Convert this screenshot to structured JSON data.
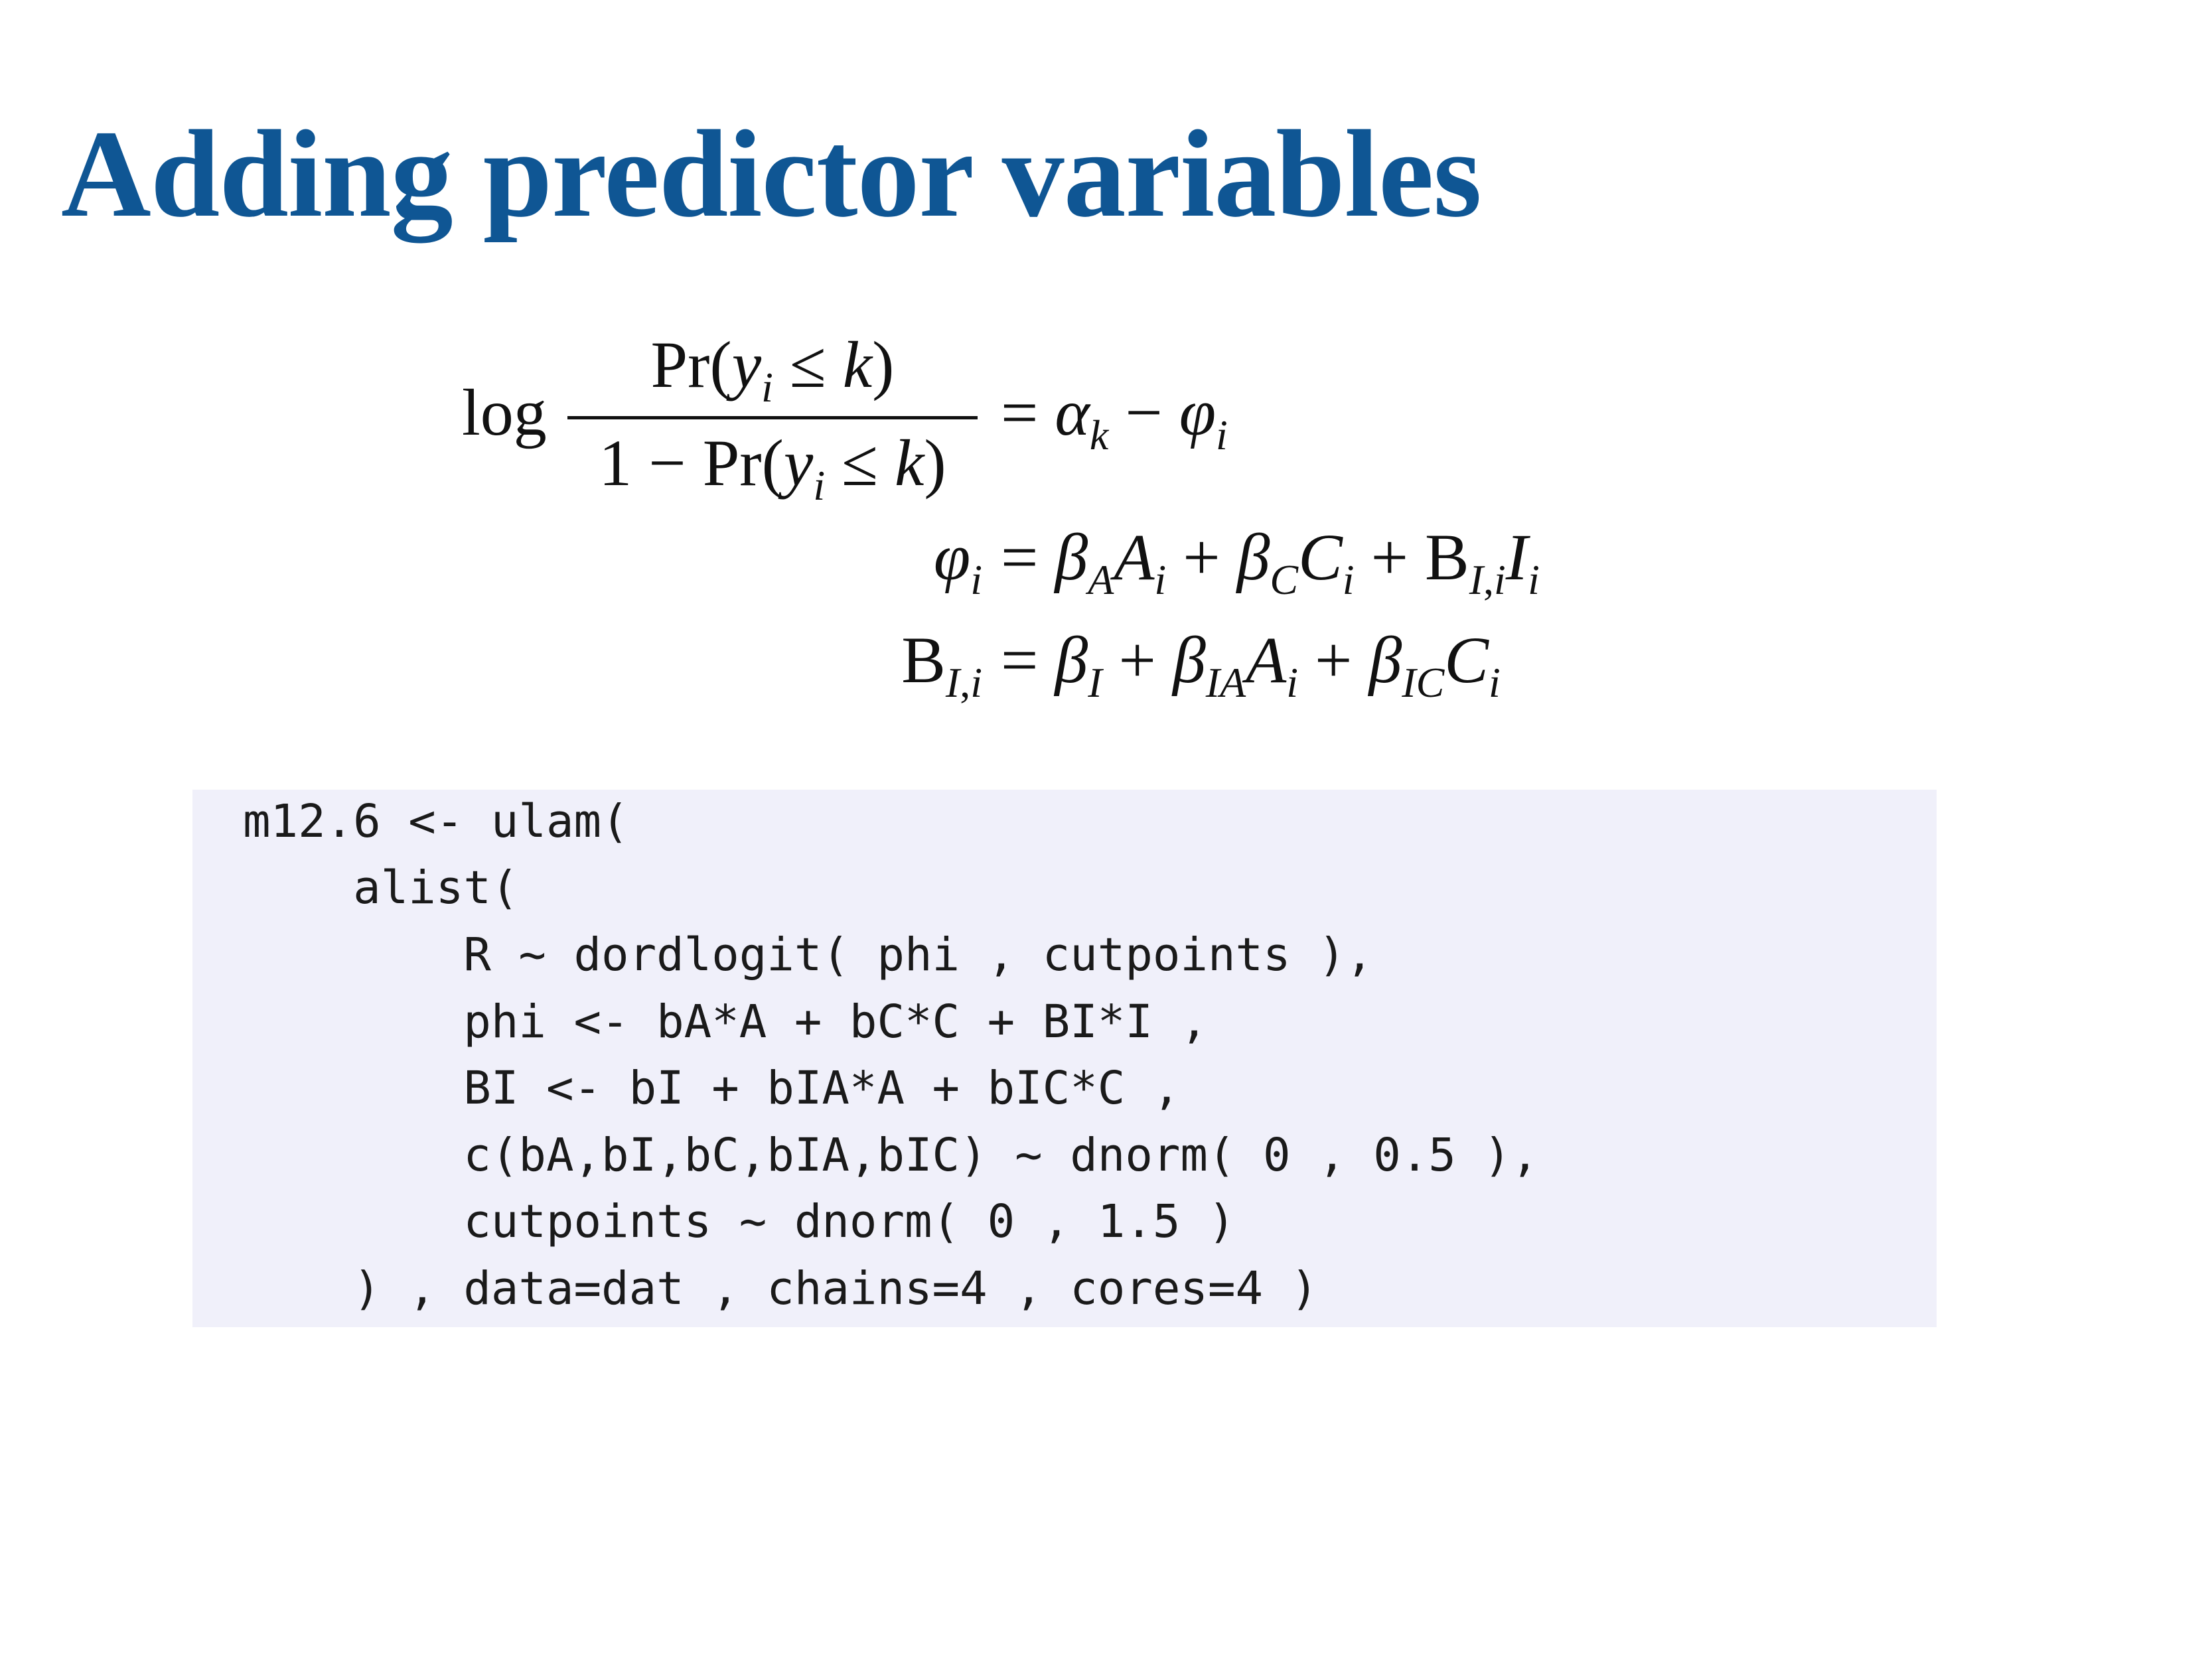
{
  "slide": {
    "title": "Adding predictor variables"
  },
  "equations": {
    "eq1": {
      "log": "log",
      "numerator": "Pr(y_i ≤ k)",
      "denominator": "1 − Pr(y_i ≤ k)",
      "rhs": "= α_k − φ_i"
    },
    "eq2": {
      "lhs": "φ_i",
      "rhs": "= β_A A_i + β_C C_i + B_{I,i} I_i"
    },
    "eq3": {
      "lhs": "B_{I,i}",
      "rhs": "= β_I + β_IA A_i + β_IC C_i"
    }
  },
  "code": {
    "lines": [
      "m12.6 <- ulam(",
      "    alist(",
      "        R ~ dordlogit( phi , cutpoints ),",
      "        phi <- bA*A + bC*C + BI*I ,",
      "        BI <- bI + bIA*A + bIC*C ,",
      "        c(bA,bI,bC,bIA,bIC) ~ dnorm( 0 , 0.5 ),",
      "        cutpoints ~ dnorm( 0 , 1.5 )",
      "    ) , data=dat , chains=4 , cores=4 )"
    ]
  },
  "colors": {
    "title": "#0f5694",
    "code_background": "#f0f0fa"
  }
}
